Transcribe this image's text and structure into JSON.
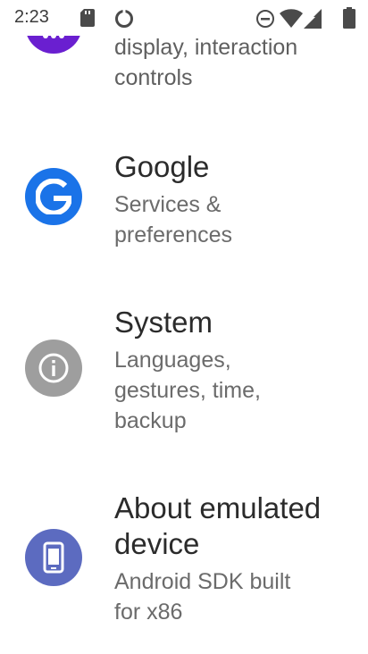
{
  "status_bar": {
    "time": "2:23",
    "icons": [
      "sd-card-icon",
      "data-saver-icon",
      "dnd-icon",
      "wifi-icon",
      "cell-signal-icon",
      "battery-icon"
    ]
  },
  "settings": {
    "items": [
      {
        "icon": "accessibility-icon",
        "color": "#6a1fd0",
        "subtitle_lines": [
          "display, interaction",
          "controls"
        ]
      },
      {
        "icon": "google-icon",
        "color": "#1a73e8",
        "title": "Google",
        "subtitle_lines": [
          "Services &",
          "preferences"
        ]
      },
      {
        "icon": "info-icon",
        "color": "#9e9e9e",
        "title": "System",
        "subtitle_lines": [
          "Languages,",
          "gestures, time,",
          "backup"
        ]
      },
      {
        "icon": "phone-icon",
        "color": "#5c6bc0",
        "title_lines": [
          "About emulated",
          "device"
        ],
        "subtitle_lines": [
          "Android SDK built",
          "for x86"
        ]
      }
    ]
  }
}
